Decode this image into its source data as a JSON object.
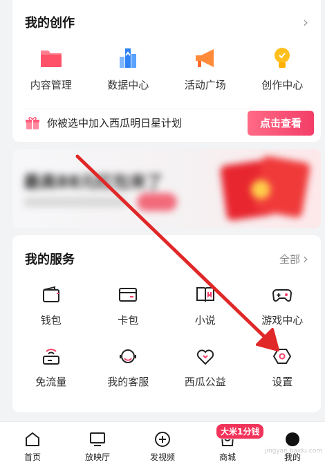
{
  "creation": {
    "title": "我的创作",
    "items": [
      {
        "label": "内容管理",
        "icon": "folder-icon"
      },
      {
        "label": "数据中心",
        "icon": "bar-chart-icon"
      },
      {
        "label": "活动广场",
        "icon": "megaphone-icon"
      },
      {
        "label": "创作中心",
        "icon": "lightbulb-icon"
      }
    ],
    "banner_text": "你被选中加入西瓜明日星计划",
    "banner_button": "点击查看"
  },
  "ad": {
    "title": "最高88元红包来了"
  },
  "services": {
    "title": "我的服务",
    "all_label": "全部",
    "items": [
      {
        "label": "钱包",
        "icon": "wallet-icon"
      },
      {
        "label": "卡包",
        "icon": "card-icon"
      },
      {
        "label": "小说",
        "icon": "book-icon"
      },
      {
        "label": "游戏中心",
        "icon": "gamepad-icon"
      },
      {
        "label": "免流量",
        "icon": "wifi-router-icon"
      },
      {
        "label": "我的客服",
        "icon": "headset-icon"
      },
      {
        "label": "西瓜公益",
        "icon": "heart-icon"
      },
      {
        "label": "设置",
        "icon": "settings-hexagon-icon"
      }
    ]
  },
  "tabbar": {
    "items": [
      {
        "label": "首页",
        "icon": "home-icon"
      },
      {
        "label": "放映厅",
        "icon": "tv-icon"
      },
      {
        "label": "发视频",
        "icon": "add-circle-icon"
      },
      {
        "label": "商城",
        "icon": "shopping-bag-icon"
      },
      {
        "label": "我的",
        "icon": "avatar-icon"
      }
    ],
    "mall_badge": "大米1分钱"
  },
  "watermark": "jingyan.baidu.com",
  "colors": {
    "accent": "#f33e68",
    "annotation_arrow": "#e02828"
  }
}
